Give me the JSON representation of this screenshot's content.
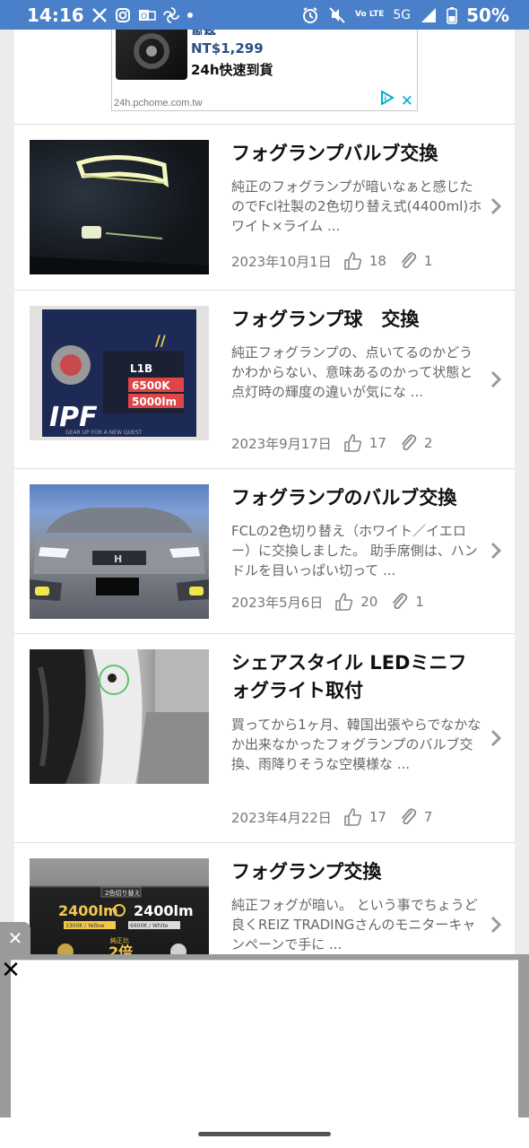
{
  "status_bar": {
    "time": "14:16",
    "battery": "50%",
    "network": "5G",
    "volte": "Vo LTE"
  },
  "ad_top": {
    "truncated_text": "風格",
    "price": "NT$1,299",
    "tagline": "24h快速到貨",
    "domain": "24h.pchome.com.tw"
  },
  "articles": [
    {
      "title": "フォグランプバルブ交換",
      "desc": "純正のフォグランプが暗いなぁと感じたのでFcl社製の2色切り替え式(4400ml)ホワイト×ライム ...",
      "date": "2023年10月1日",
      "likes": "18",
      "clips": "1"
    },
    {
      "title": "フォグランプ球　交換",
      "desc": "純正フォグランプの、点いてるのかどうかわからない、意味あるのかって状態と点灯時の輝度の違いが気にな ...",
      "date": "2023年9月17日",
      "likes": "17",
      "clips": "2"
    },
    {
      "title": "フォグランプのバルブ交換",
      "desc": "FCLの2色切り替え（ホワイト／イエロー）に交換しました。 助手席側は、ハンドルを目いっぱい切って ...",
      "date": "2023年5月6日",
      "likes": "20",
      "clips": "1"
    },
    {
      "title": "シェアスタイル LEDミニフォグライト取付",
      "desc": "買ってから1ヶ月、韓国出張やらでなかなか出来なかったフォグランプのバルブ交換、雨降りそうな空模様な ...",
      "date": "2023年4月22日",
      "likes": "17",
      "clips": "7"
    },
    {
      "title": "フォグランプ交換",
      "desc": "純正フォグが暗い。 という事でちょうど良くREIZ TRADINGさんのモニターキャンペーンで手に ..."
    }
  ],
  "thumb_text": {
    "t2_brand": "IPF",
    "t2_model": "L1B",
    "t2_kelvin": "6500K",
    "t2_lumen": "5000lm",
    "t2_slogan": "GEAR UP FOR A NEW QUEST",
    "t5_label": "2色切り替え",
    "t5_lm_left": "2400lm",
    "t5_lm_right": "2400lm",
    "t5_left_sub": "3300K / Yellow",
    "t5_right_sub": "6600K / White",
    "t5_center_top": "純正比",
    "t5_center": "2倍"
  },
  "colors": {
    "status_bar": "#4a80c9",
    "ad_accent": "#00aecd",
    "page_bg": "#ececec"
  },
  "icons": [
    "twitter-x-icon",
    "instagram-icon",
    "outlook-icon",
    "pinwheel-icon",
    "alarm-icon",
    "mute-icon",
    "signal-icon",
    "battery-icon",
    "like-icon",
    "clip-icon",
    "chevron-right-icon",
    "close-icon"
  ]
}
